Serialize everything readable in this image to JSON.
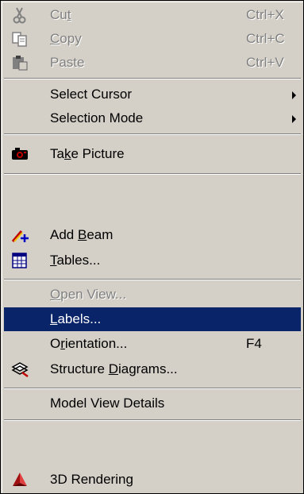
{
  "menu": {
    "items": [
      {
        "key": "cut",
        "label": "Cut",
        "mnemonic": 2,
        "shortcut": "Ctrl+X",
        "enabled": false,
        "icon": "scissors-icon"
      },
      {
        "key": "copy",
        "label": "Copy",
        "mnemonic": 0,
        "shortcut": "Ctrl+C",
        "enabled": false,
        "icon": "copy-icon"
      },
      {
        "key": "paste",
        "label": "Paste",
        "mnemonic": -1,
        "shortcut": "Ctrl+V",
        "enabled": false,
        "icon": "paste-icon"
      },
      {
        "key": "select-cursor",
        "label": "Select Cursor",
        "mnemonic": -1,
        "submenu": true
      },
      {
        "key": "selection-mode",
        "label": "Selection Mode",
        "mnemonic": -1,
        "submenu": true
      },
      {
        "key": "take-picture",
        "label": "Take Picture",
        "mnemonic": 2,
        "icon": "camera-icon"
      },
      {
        "key": "add-beam",
        "label": "Add Beam",
        "mnemonic": 4,
        "icon": "add-beam-icon"
      },
      {
        "key": "tables",
        "label": "Tables...",
        "mnemonic": 0,
        "icon": "table-icon"
      },
      {
        "key": "open-view",
        "label": "Open View...",
        "mnemonic": 0,
        "enabled": false
      },
      {
        "key": "labels",
        "label": "Labels...",
        "mnemonic": 0,
        "highlighted": true
      },
      {
        "key": "orientation",
        "label": "Orientation...",
        "mnemonic": 1,
        "shortcut": "F4"
      },
      {
        "key": "structure-diagrams",
        "label": "Structure Diagrams...",
        "mnemonic": 10,
        "icon": "structure-diagram-icon"
      },
      {
        "key": "model-view-details",
        "label": "Model View Details",
        "mnemonic": -1
      },
      {
        "key": "3d-rendering",
        "label": "3D Rendering",
        "mnemonic": -1,
        "icon": "rendering-3d-icon"
      }
    ]
  },
  "colors": {
    "menu_background": "#d4d0c8",
    "highlight": "#0a246a",
    "highlight_text": "#ffffff",
    "disabled_text": "#808080"
  }
}
